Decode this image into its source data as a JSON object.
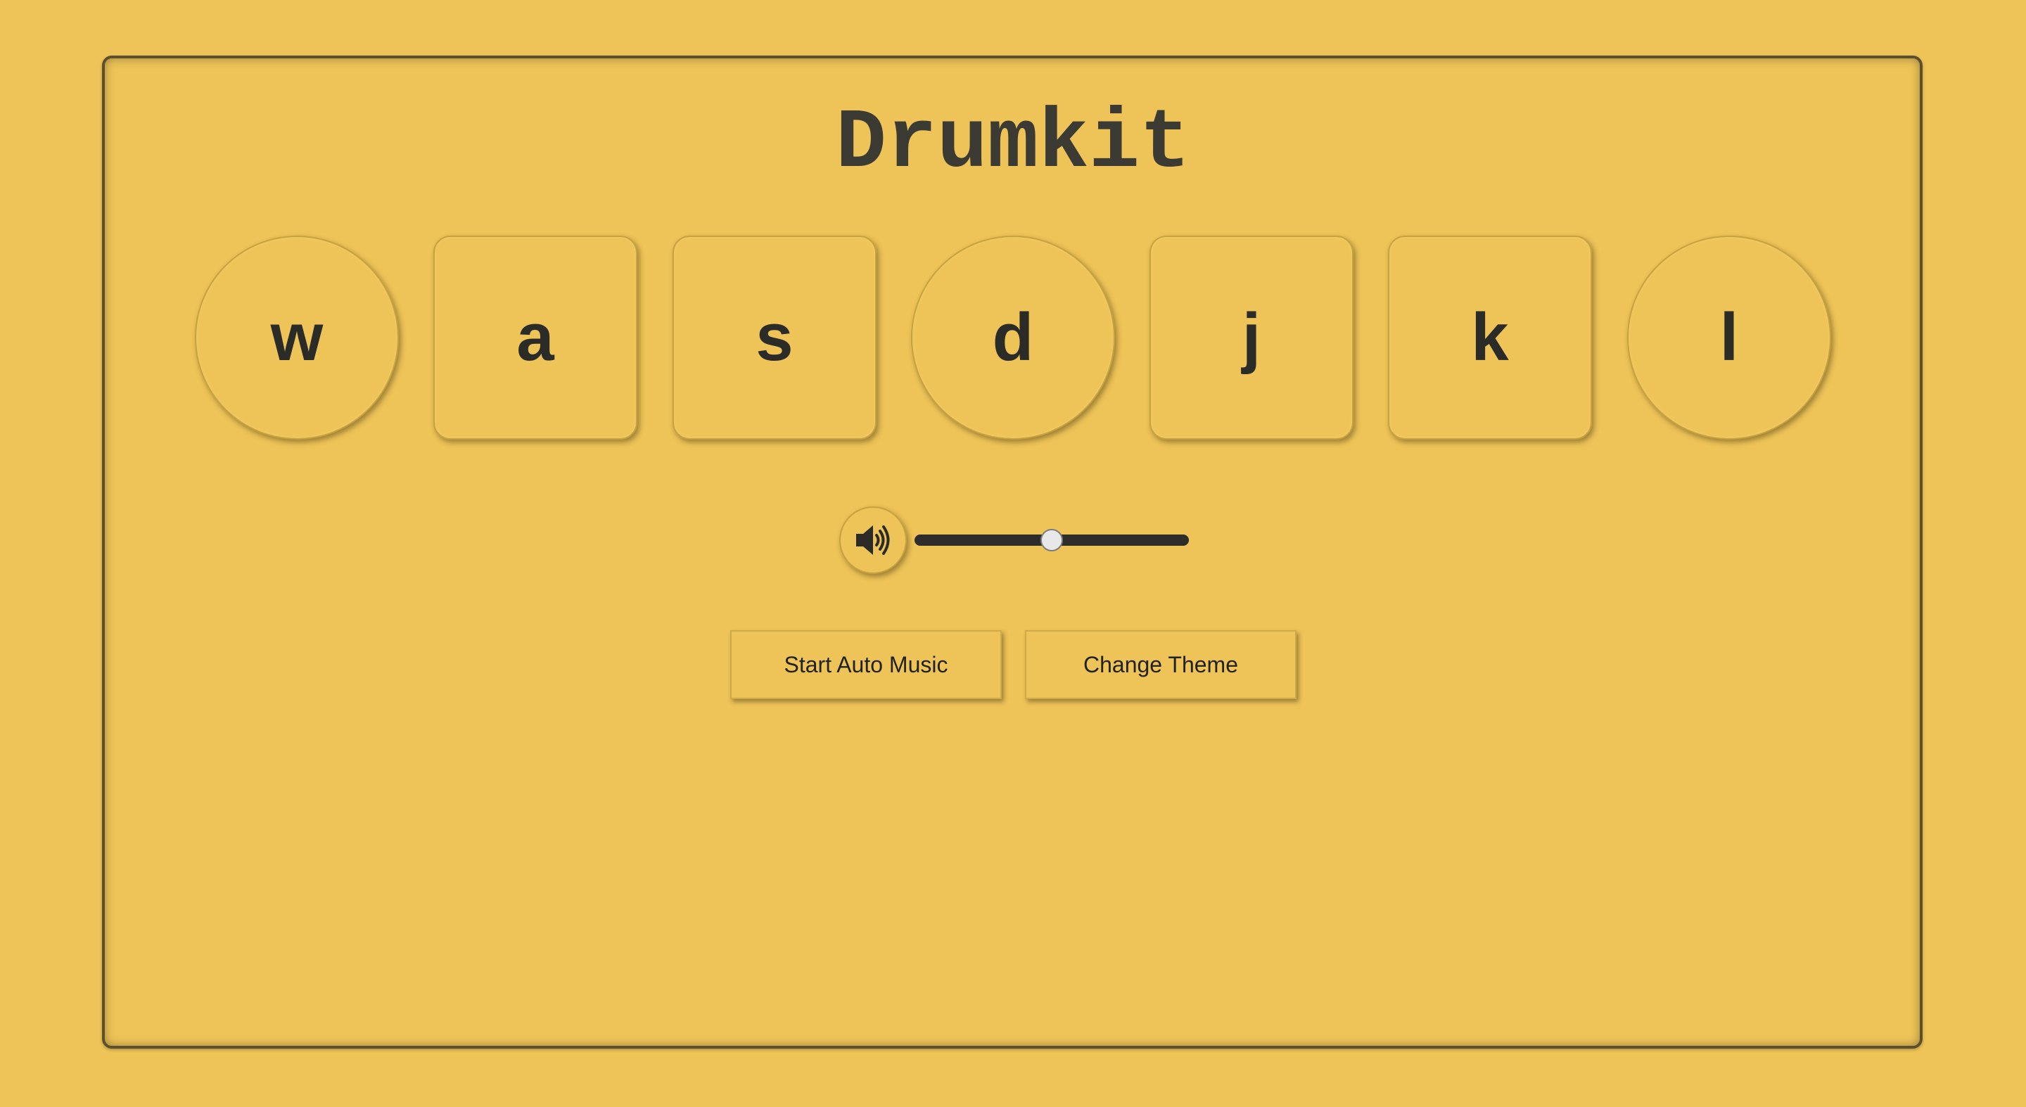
{
  "app": {
    "title": "Drumkit"
  },
  "keys": [
    {
      "label": "w",
      "shape": "round"
    },
    {
      "label": "a",
      "shape": "square"
    },
    {
      "label": "s",
      "shape": "square"
    },
    {
      "label": "d",
      "shape": "round"
    },
    {
      "label": "j",
      "shape": "square"
    },
    {
      "label": "k",
      "shape": "square"
    },
    {
      "label": "l",
      "shape": "round"
    }
  ],
  "volume": {
    "icon": "speaker-volume-icon",
    "value": 0.5
  },
  "controls": {
    "auto_music_label": "Start Auto Music",
    "theme_label": "Change Theme"
  },
  "colors": {
    "background": "#eec458",
    "text": "#2b2b28",
    "frame_border": "#5a5030"
  }
}
